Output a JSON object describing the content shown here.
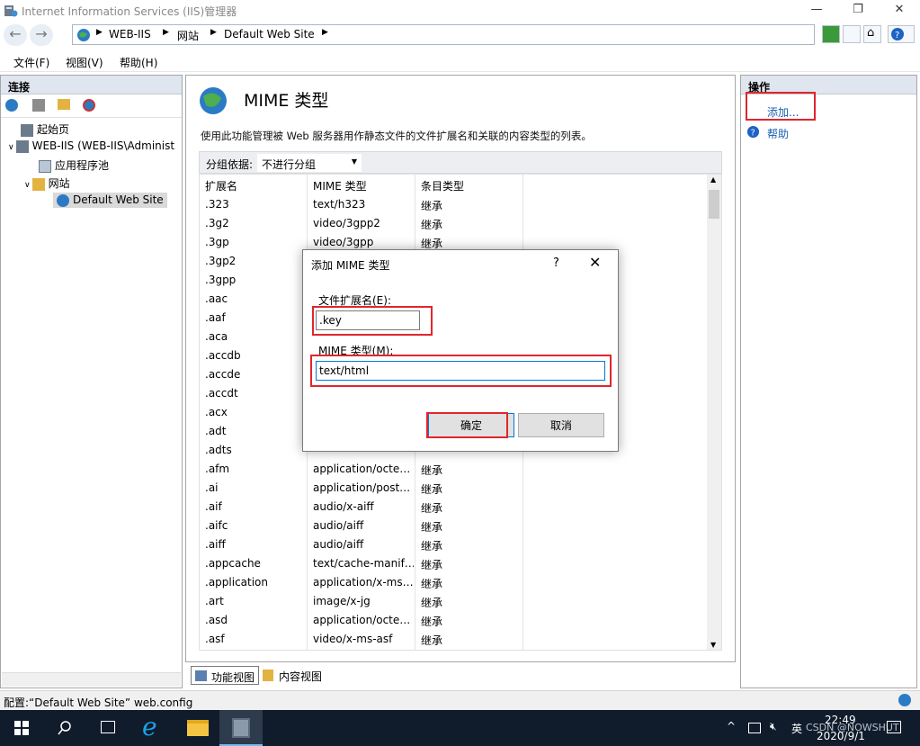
{
  "window": {
    "title": "Internet Information Services (IIS)管理器",
    "controls": [
      "—",
      "❐",
      "✕"
    ]
  },
  "address": {
    "crumbs": [
      "WEB-IIS",
      "网站",
      "Default Web Site"
    ]
  },
  "menu": [
    "文件(F)",
    "视图(V)",
    "帮助(H)"
  ],
  "connections": {
    "header": "连接",
    "tree": [
      {
        "label": "起始页",
        "icon": "start-page-icon"
      },
      {
        "label": "WEB-IIS (WEB-IIS\\Administ",
        "icon": "server-icon"
      },
      {
        "label": "应用程序池",
        "icon": "app-pool-icon"
      },
      {
        "label": "网站",
        "icon": "sites-folder-icon"
      },
      {
        "label": "Default Web Site",
        "icon": "globe-icon"
      }
    ]
  },
  "main": {
    "title": "MIME 类型",
    "description": "使用此功能管理被 Web 服务器用作静态文件的文件扩展名和关联的内容类型的列表。",
    "group_label": "分组依据:",
    "group_value": "不进行分组",
    "columns": [
      "扩展名",
      "MIME 类型",
      "条目类型"
    ],
    "rows": [
      [
        ".323",
        "text/h323",
        "继承"
      ],
      [
        ".3g2",
        "video/3gpp2",
        "继承"
      ],
      [
        ".3gp",
        "video/3gpp",
        "继承"
      ],
      [
        ".3gp2",
        "",
        ""
      ],
      [
        ".3gpp",
        "",
        ""
      ],
      [
        ".aac",
        "",
        ""
      ],
      [
        ".aaf",
        "",
        ""
      ],
      [
        ".aca",
        "",
        ""
      ],
      [
        ".accdb",
        "",
        ""
      ],
      [
        ".accde",
        "",
        ""
      ],
      [
        ".accdt",
        "",
        ""
      ],
      [
        ".acx",
        "",
        ""
      ],
      [
        ".adt",
        "",
        ""
      ],
      [
        ".adts",
        "",
        ""
      ],
      [
        ".afm",
        "application/octe…",
        "继承"
      ],
      [
        ".ai",
        "application/post…",
        "继承"
      ],
      [
        ".aif",
        "audio/x-aiff",
        "继承"
      ],
      [
        ".aifc",
        "audio/aiff",
        "继承"
      ],
      [
        ".aiff",
        "audio/aiff",
        "继承"
      ],
      [
        ".appcache",
        "text/cache-manif…",
        "继承"
      ],
      [
        ".application",
        "application/x-ms…",
        "继承"
      ],
      [
        ".art",
        "image/x-jg",
        "继承"
      ],
      [
        ".asd",
        "application/octe…",
        "继承"
      ],
      [
        ".asf",
        "video/x-ms-asf",
        "继承"
      ]
    ],
    "view_tabs": [
      "功能视图",
      "内容视图"
    ]
  },
  "actions": {
    "header": "操作",
    "add": "添加...",
    "help": "帮助"
  },
  "status": "配置:“Default Web Site” web.config",
  "taskbar": {
    "ime": "英",
    "time": "22:49",
    "date": "2020/9/1",
    "watermark": "CSDN @NOWSHUT"
  },
  "dialog": {
    "title": "添加 MIME 类型",
    "help": "?",
    "close": "✕",
    "ext_label": "文件扩展名(E):",
    "ext_value": ".key",
    "mime_label": "MIME 类型(M):",
    "mime_value": "text/html",
    "ok": "确定",
    "cancel": "取消"
  },
  "colors": {
    "highlight": "#e0262c",
    "link": "#1a5fb4",
    "taskbar": "#101c2b"
  }
}
